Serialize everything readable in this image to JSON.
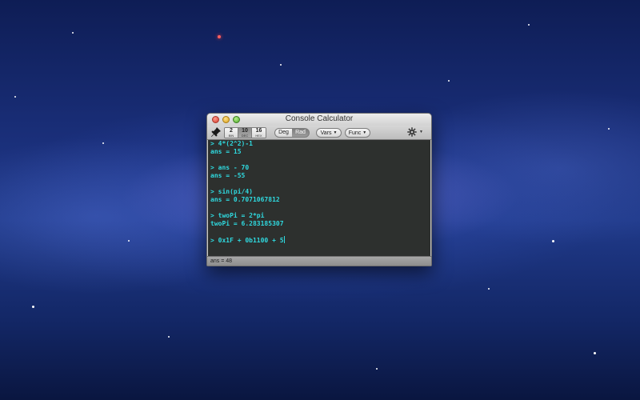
{
  "window": {
    "title": "Console Calculator"
  },
  "toolbar": {
    "pin_icon": "pin-icon",
    "base_buttons": [
      {
        "number": "2",
        "label": "BIN"
      },
      {
        "number": "10",
        "label": "DEC",
        "active": true
      },
      {
        "number": "16",
        "label": "HEX"
      }
    ],
    "angle_deg": "Deg",
    "angle_rad": "Rad",
    "angle_selected": "Rad",
    "vars_label": "Vars",
    "func_label": "Func",
    "gear_icon": "gear-icon",
    "caret_icon": "chevron-down-icon"
  },
  "console": {
    "lines": [
      "> 4*(2^2)-1",
      "ans = 15",
      "",
      "> ans - 70",
      "ans = -55",
      "",
      "> sin(pi/4)",
      "ans = 0.7071067812",
      "",
      "> twoPi = 2*pi",
      "twoPi = 6.283185307",
      "",
      "> 0x1F + 0b1100 + 5"
    ],
    "text_color": "#2fd9df",
    "background": "#2d302e"
  },
  "status": {
    "text": "ans = 48"
  }
}
